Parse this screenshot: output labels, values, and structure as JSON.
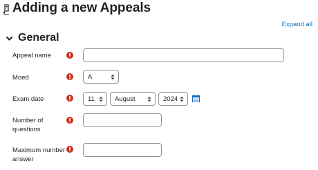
{
  "page": {
    "title": "Adding a new Appeals",
    "expand_all_label": "Expand all"
  },
  "section": {
    "title": "General"
  },
  "form": {
    "appeal_name": {
      "label": "Appeal name",
      "value": ""
    },
    "moed": {
      "label": "Moed",
      "selected": "A"
    },
    "exam_date": {
      "label": "Exam date",
      "day": "11",
      "month": "August",
      "year": "2024"
    },
    "number_of_questions": {
      "label_line1": "Number of",
      "label_line2": "questions",
      "value": ""
    },
    "maximum_number_of_answer": {
      "label_line1": "Maximum number of",
      "label_line2": "answer",
      "value": ""
    }
  },
  "icons": {
    "required": "exclamation-circle-icon",
    "calendar": "calendar-icon",
    "chevron": "chevron-down-icon",
    "heading": "module-icon"
  },
  "colors": {
    "required_red": "#ca3120",
    "link_blue": "#0f6cbf",
    "calendar_blue": "#0f6cbf"
  }
}
